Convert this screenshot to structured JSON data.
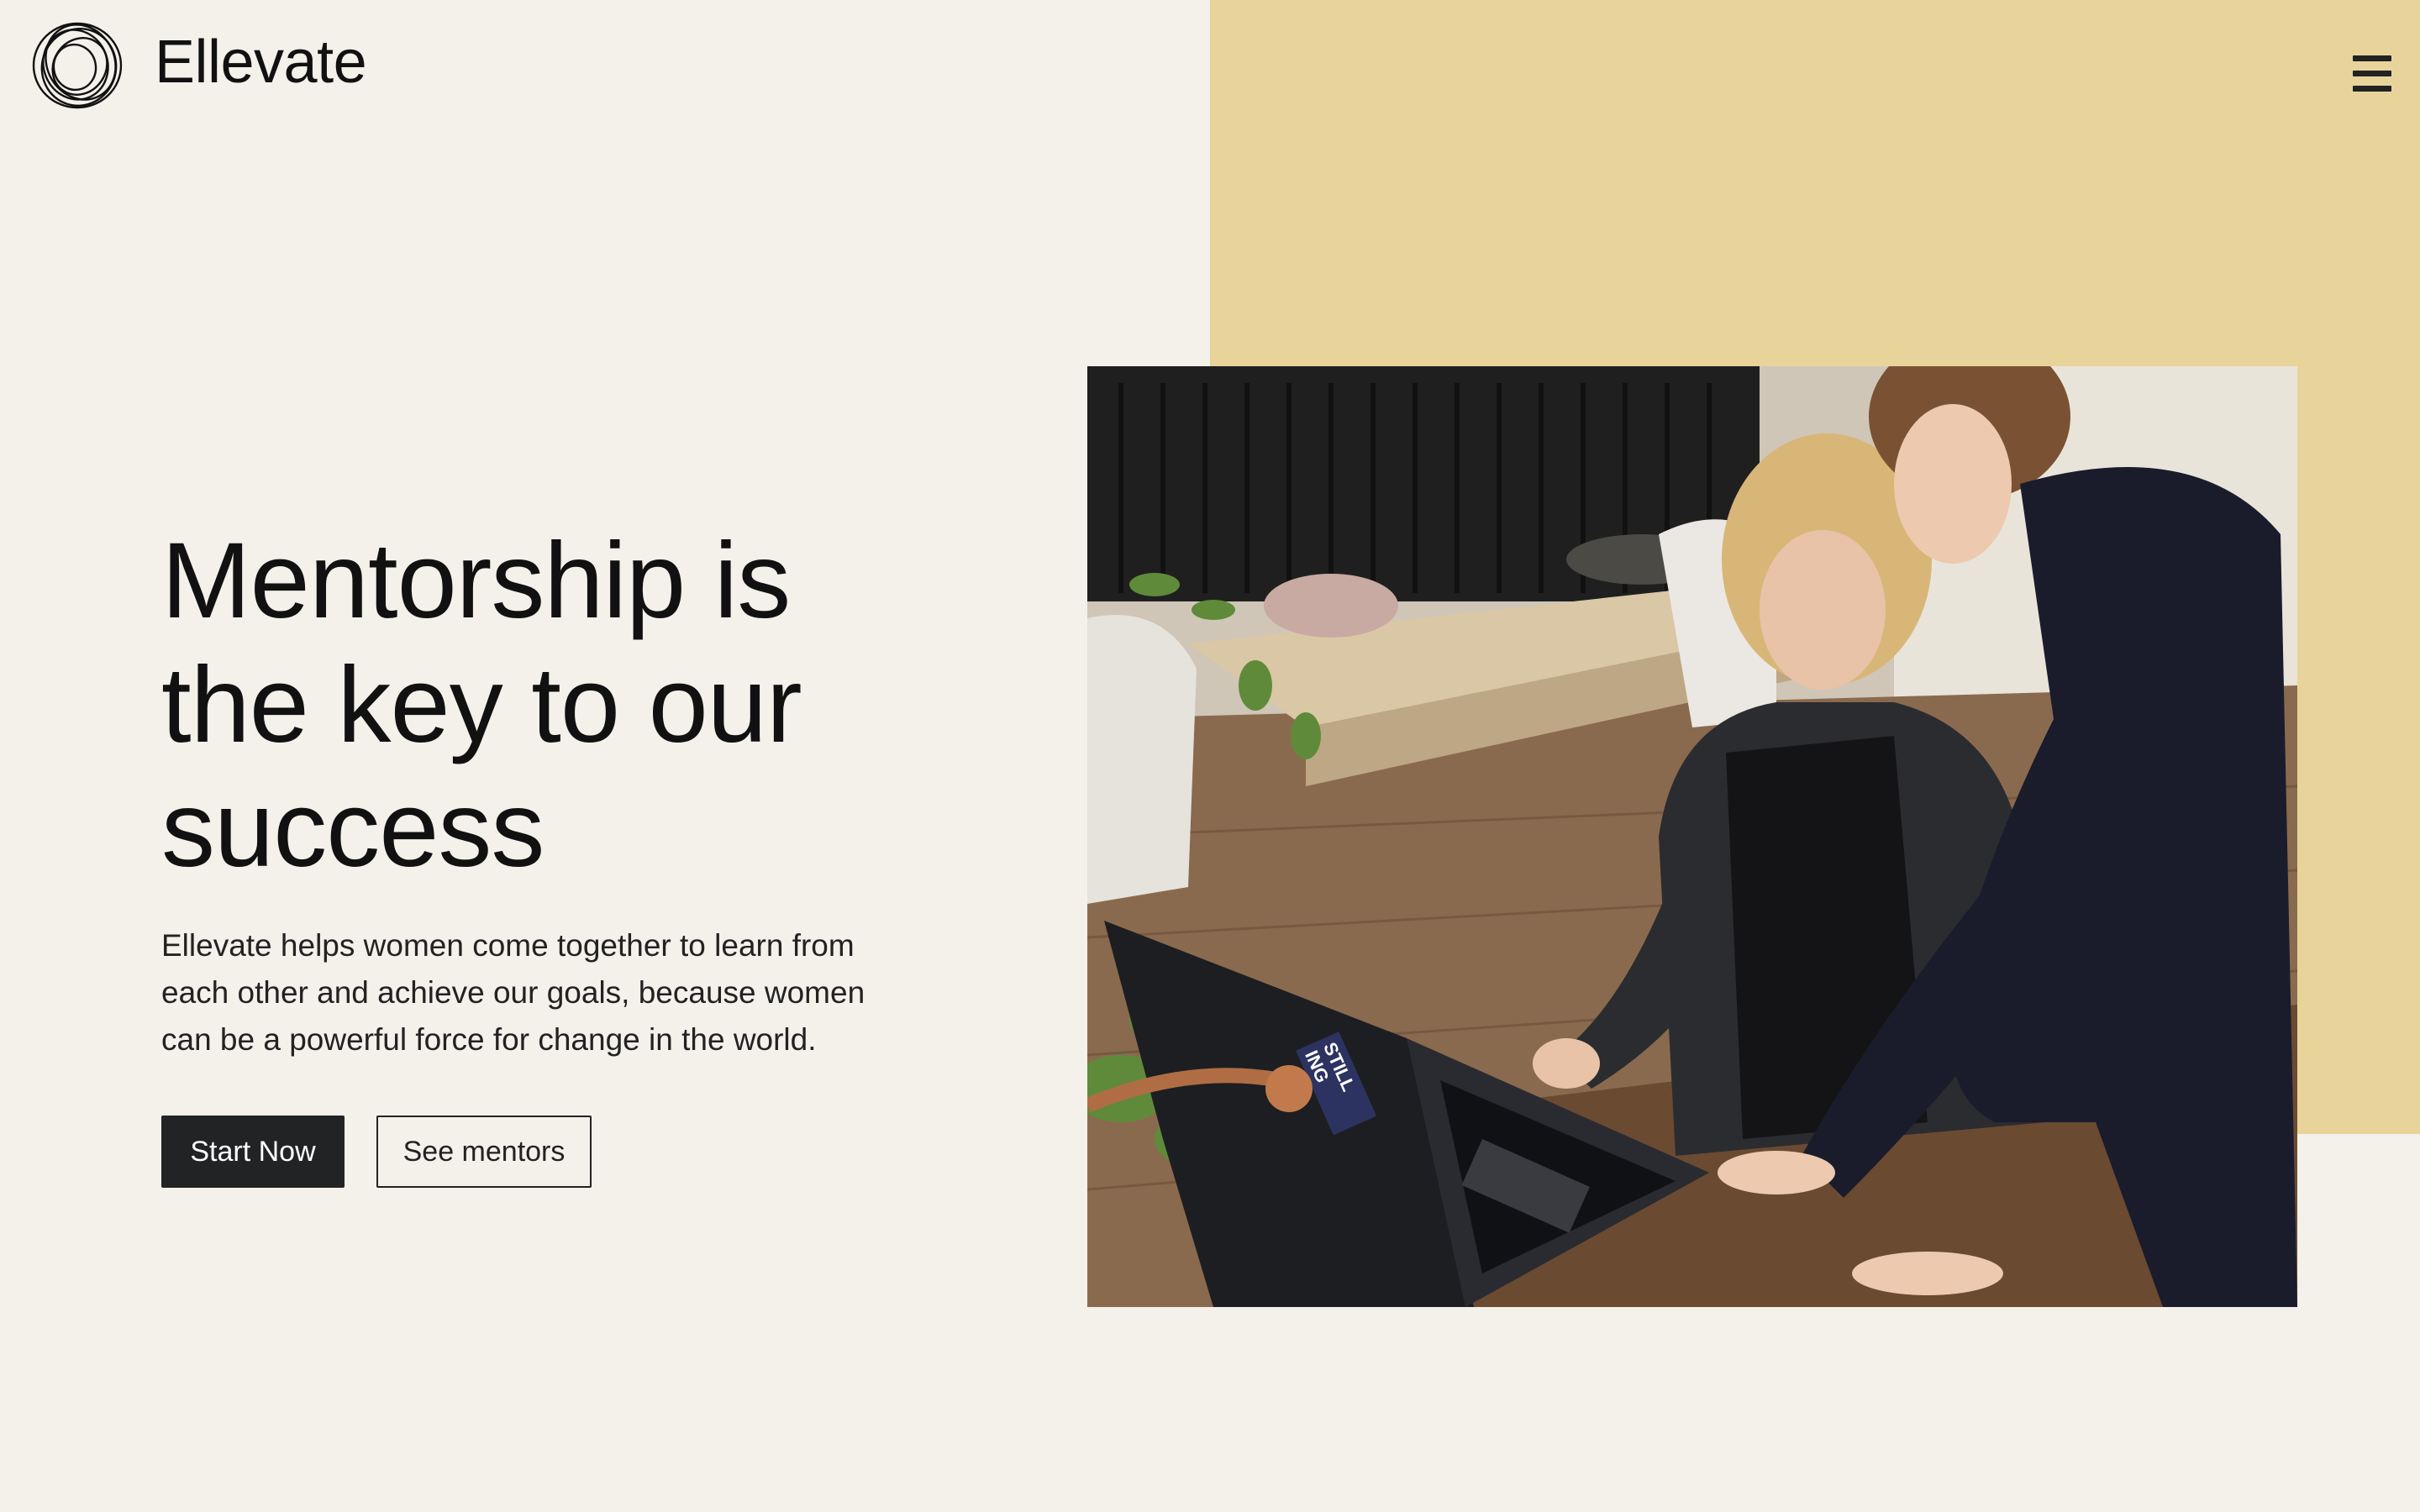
{
  "brand": {
    "name": "Ellevate",
    "logo_icon": "scribble-circle-logo-icon"
  },
  "nav": {
    "menu_icon": "hamburger-menu-icon"
  },
  "hero": {
    "headline": "Mentorship is the key to our success",
    "description": "Ellevate helps women come together to learn from each other and achieve our goals, because women can be a powerful force for change in the world.",
    "primary_button": "Start Now",
    "secondary_button": "See mentors",
    "image_alt": "Two women working together at a laptop"
  },
  "laptop_sticker": {
    "line1": "STILL",
    "line2": "ING"
  },
  "colors": {
    "background": "#f4f1ea",
    "accent_block": "#e8d49b",
    "primary_button": "#222325",
    "text": "#111111"
  }
}
